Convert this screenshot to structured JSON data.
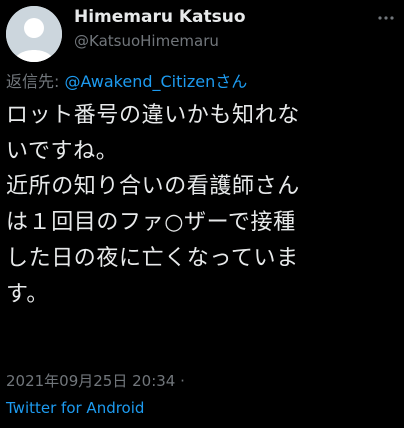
{
  "author": {
    "display_name": "Himemaru Katsuo",
    "handle": "@KatsuoHimemaru",
    "avatar_icon": "default-profile-icon"
  },
  "reply": {
    "prefix": "返信先: ",
    "mention": "@Awakend_Citizenさん"
  },
  "tweet": {
    "lines": [
      "ロット番号の違いかも知れな",
      "いですね。",
      "近所の知り合いの看護師さん",
      "は１回目のファ○ザーで接種",
      "した日の夜に亡くなっていま",
      "す。"
    ]
  },
  "meta": {
    "timestamp": "2021年09月25日 20:34 ·",
    "source": "Twitter for Android"
  },
  "colors": {
    "background": "#000000",
    "text": "#e7e9ea",
    "secondary": "#71767b",
    "link": "#1d9bf0"
  }
}
